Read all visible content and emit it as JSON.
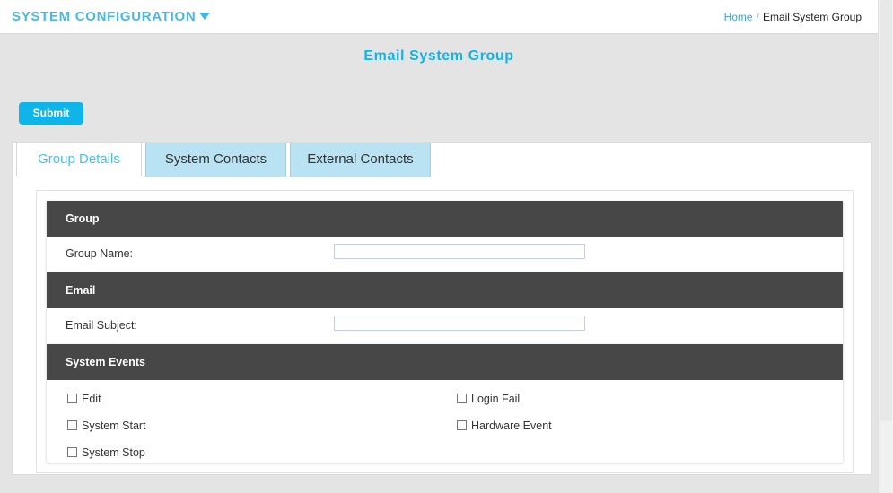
{
  "topbar": {
    "brand": "SYSTEM CONFIGURATION",
    "caret_icon": "chevron-down-icon",
    "breadcrumb": {
      "home": "Home",
      "separator": "/",
      "current": "Email System Group"
    }
  },
  "page": {
    "title": "Email System Group",
    "accent_color": "#0fb4e8",
    "header_bg": "#474747",
    "body_bg": "#e4e4e4"
  },
  "toolbar": {
    "submit_label": "Submit"
  },
  "tabs": [
    {
      "label": "Group Details",
      "active": true
    },
    {
      "label": "System Contacts",
      "active": false
    },
    {
      "label": "External Contacts",
      "active": false
    }
  ],
  "sections": {
    "group": {
      "header": "Group",
      "fields": [
        {
          "label": "Group Name:",
          "value": "",
          "placeholder": ""
        }
      ]
    },
    "email": {
      "header": "Email",
      "fields": [
        {
          "label": "Email Subject:",
          "value": "",
          "placeholder": ""
        }
      ]
    },
    "system_events": {
      "header": "System Events",
      "left_column": [
        {
          "label": "Edit",
          "checked": false
        },
        {
          "label": "System Start",
          "checked": false
        },
        {
          "label": "System Stop",
          "checked": false
        }
      ],
      "right_column": [
        {
          "label": "Login Fail",
          "checked": false
        },
        {
          "label": "Hardware Event",
          "checked": false
        }
      ]
    }
  }
}
